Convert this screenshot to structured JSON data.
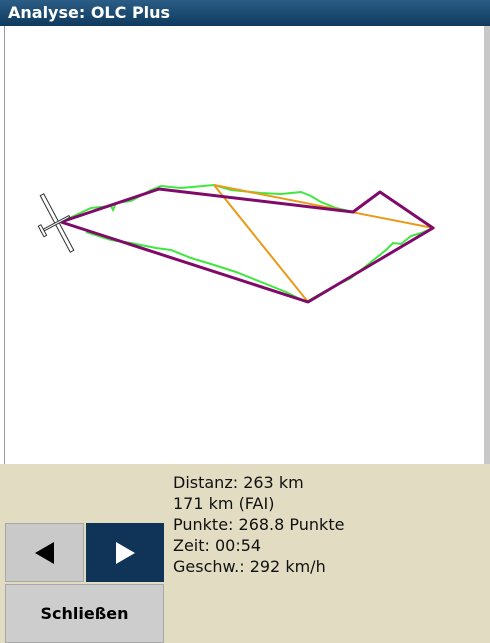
{
  "window": {
    "title": "Analyse: OLC Plus"
  },
  "icons": {
    "glider": "glider-icon",
    "prev": "arrow-left-icon",
    "next": "arrow-right-icon"
  },
  "colors": {
    "titlebar": "#0f3a5e",
    "panel": "#e1dcc2",
    "optimized_route": "#800a6a",
    "flight_track": "#3fe83f",
    "triangle": "#e89a18",
    "next_button": "#0f3458"
  },
  "stats": {
    "distance": "Distanz: 263 km",
    "fai_distance": "171 km (FAI)",
    "points": "Punkte: 268.8 Punkte",
    "time": "Zeit: 00:54",
    "speed": "Geschw.: 292 km/h"
  },
  "buttons": {
    "close_label": "Schließen"
  }
}
